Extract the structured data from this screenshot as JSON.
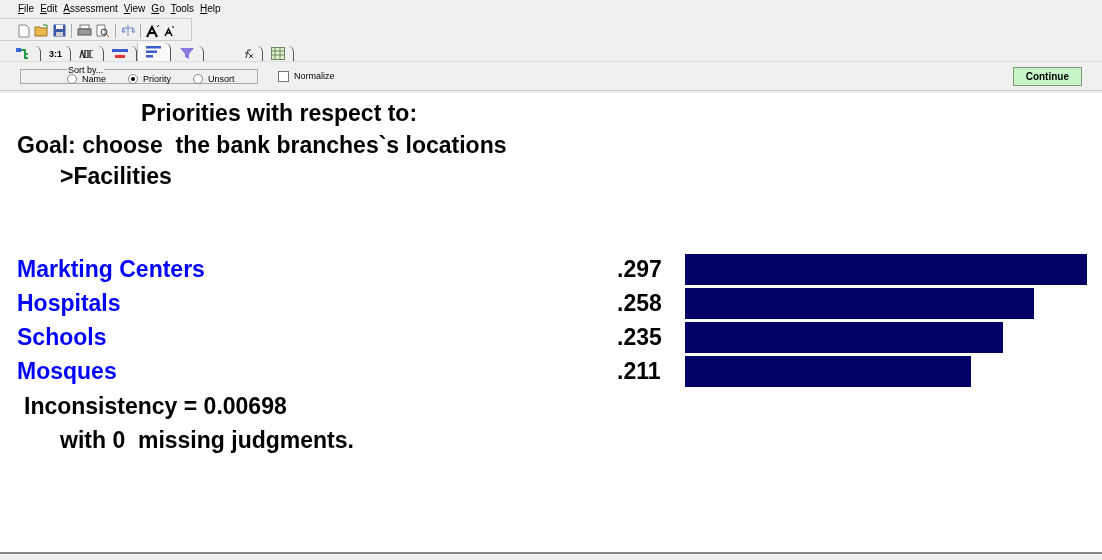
{
  "menu": [
    "File",
    "Edit",
    "Assessment",
    "View",
    "Go",
    "Tools",
    "Help"
  ],
  "toolbar": [
    {
      "kind": "new"
    },
    {
      "kind": "open"
    },
    {
      "kind": "save"
    },
    {
      "kind": "sep"
    },
    {
      "kind": "print"
    },
    {
      "kind": "preview"
    },
    {
      "kind": "sep"
    },
    {
      "kind": "scale"
    },
    {
      "kind": "sep"
    },
    {
      "kind": "font-up"
    },
    {
      "kind": "font-down"
    }
  ],
  "tabs": [
    {
      "kind": "tree",
      "selected": false
    },
    {
      "kind": "text",
      "label": "3:1",
      "selected": false
    },
    {
      "kind": "abc",
      "selected": false
    },
    {
      "kind": "bar-red",
      "selected": false
    },
    {
      "kind": "bars",
      "selected": true
    },
    {
      "kind": "funnel",
      "selected": false
    },
    {
      "kind": "gap"
    },
    {
      "kind": "fx",
      "selected": false
    },
    {
      "kind": "grid",
      "selected": false
    }
  ],
  "sort": {
    "legend": "Sort by...",
    "options": [
      {
        "label": "Name",
        "selected": false
      },
      {
        "label": "Priority",
        "selected": true
      },
      {
        "label": "Unsort",
        "selected": false
      }
    ]
  },
  "normalize": {
    "label": "Normalize",
    "checked": false
  },
  "continue_button": "Continue",
  "heading": "Priorities with respect to:",
  "goal": "Goal: choose  the bank branches`s locations",
  "node": ">Facilities",
  "priorities": [
    {
      "name": "Markting Centers",
      "value": ".297"
    },
    {
      "name": "Hospitals",
      "value": ".258"
    },
    {
      "name": "Schools",
      "value": ".235"
    },
    {
      "name": "Mosques",
      "value": ".211"
    }
  ],
  "inconsistency": "Inconsistency = 0.00698",
  "missing": "with 0  missing judgments."
}
